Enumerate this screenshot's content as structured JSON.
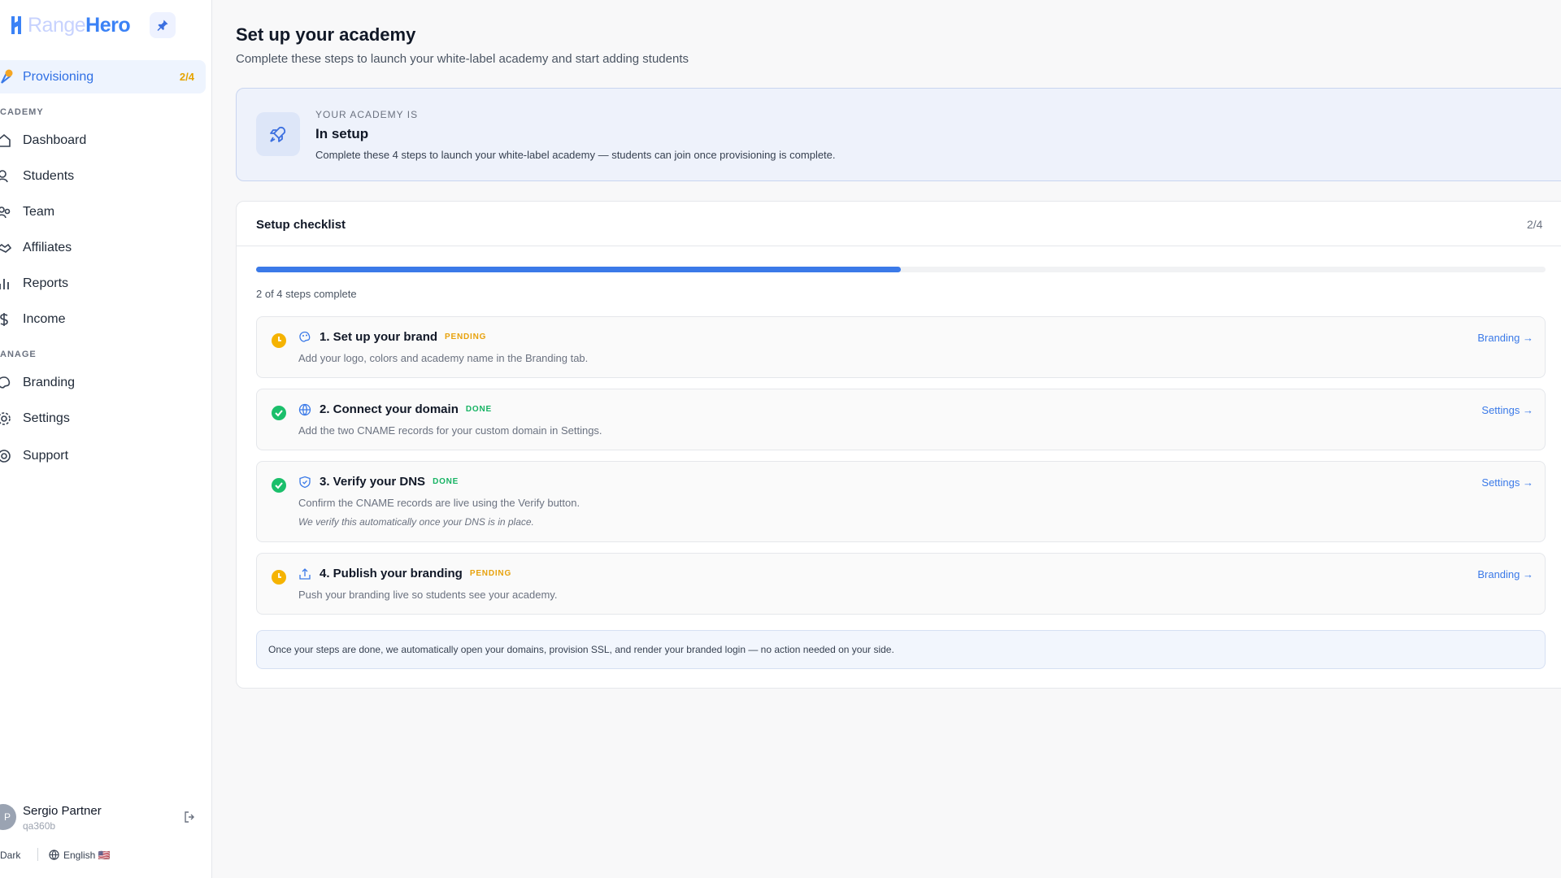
{
  "brand": {
    "name_light": "Range",
    "name_bold": "Hero"
  },
  "sidebar": {
    "provisioning": {
      "label": "Provisioning",
      "badge": "2/4"
    },
    "sections": [
      {
        "label": "CADEMY",
        "items": [
          {
            "label": "Dashboard",
            "icon": "home-icon"
          },
          {
            "label": "Students",
            "icon": "users-icon"
          },
          {
            "label": "Team",
            "icon": "team-icon"
          },
          {
            "label": "Affiliates",
            "icon": "handshake-icon"
          },
          {
            "label": "Reports",
            "icon": "bar-chart-icon"
          },
          {
            "label": "Income",
            "icon": "dollar-icon"
          }
        ]
      },
      {
        "label": "ANAGE",
        "items": [
          {
            "label": "Branding",
            "icon": "palette-icon"
          },
          {
            "label": "Settings",
            "icon": "gear-icon"
          },
          {
            "label": "Support",
            "icon": "lifebuoy-icon"
          }
        ]
      }
    ],
    "user": {
      "initial": "P",
      "name": "Sergio Partner",
      "id": "qa360b"
    },
    "footer": {
      "theme": "Dark",
      "language": "English 🇺🇸"
    }
  },
  "main": {
    "title": "Set up your academy",
    "subtitle": "Complete these steps to launch your white-label academy and start adding students",
    "status": {
      "eyebrow": "YOUR ACADEMY IS",
      "title": "In setup",
      "description": "Complete these 4 steps to launch your white-label academy — students can join once provisioning is complete."
    },
    "checklist": {
      "title": "Setup checklist",
      "count": "2/4",
      "progress_fraction": 0.5,
      "progress_text": "2 of 4 steps complete",
      "steps": [
        {
          "title": "1. Set up your brand",
          "badge": "PENDING",
          "description": "Add your logo, colors and academy name in the Branding tab.",
          "link": "Branding →",
          "note": ""
        },
        {
          "title": "2. Connect your domain",
          "badge": "DONE",
          "description": "Add the two CNAME records for your custom domain in Settings.",
          "link": "Settings →",
          "note": ""
        },
        {
          "title": "3. Verify your DNS",
          "badge": "DONE",
          "description": "Confirm the CNAME records are live using the Verify button.",
          "link": "Settings →",
          "note": "We verify this automatically once your DNS is in place."
        },
        {
          "title": "4. Publish your branding",
          "badge": "PENDING",
          "description": "Push your branding live so students see your academy.",
          "link": "Branding →",
          "note": ""
        }
      ],
      "info_note": "Once your steps are done, we automatically open your domains, provision SSL, and render your branded login — no action needed on your side."
    }
  },
  "colors": {
    "accent": "#3b7ae8",
    "pending": "#e8a20c",
    "done": "#16b363"
  }
}
